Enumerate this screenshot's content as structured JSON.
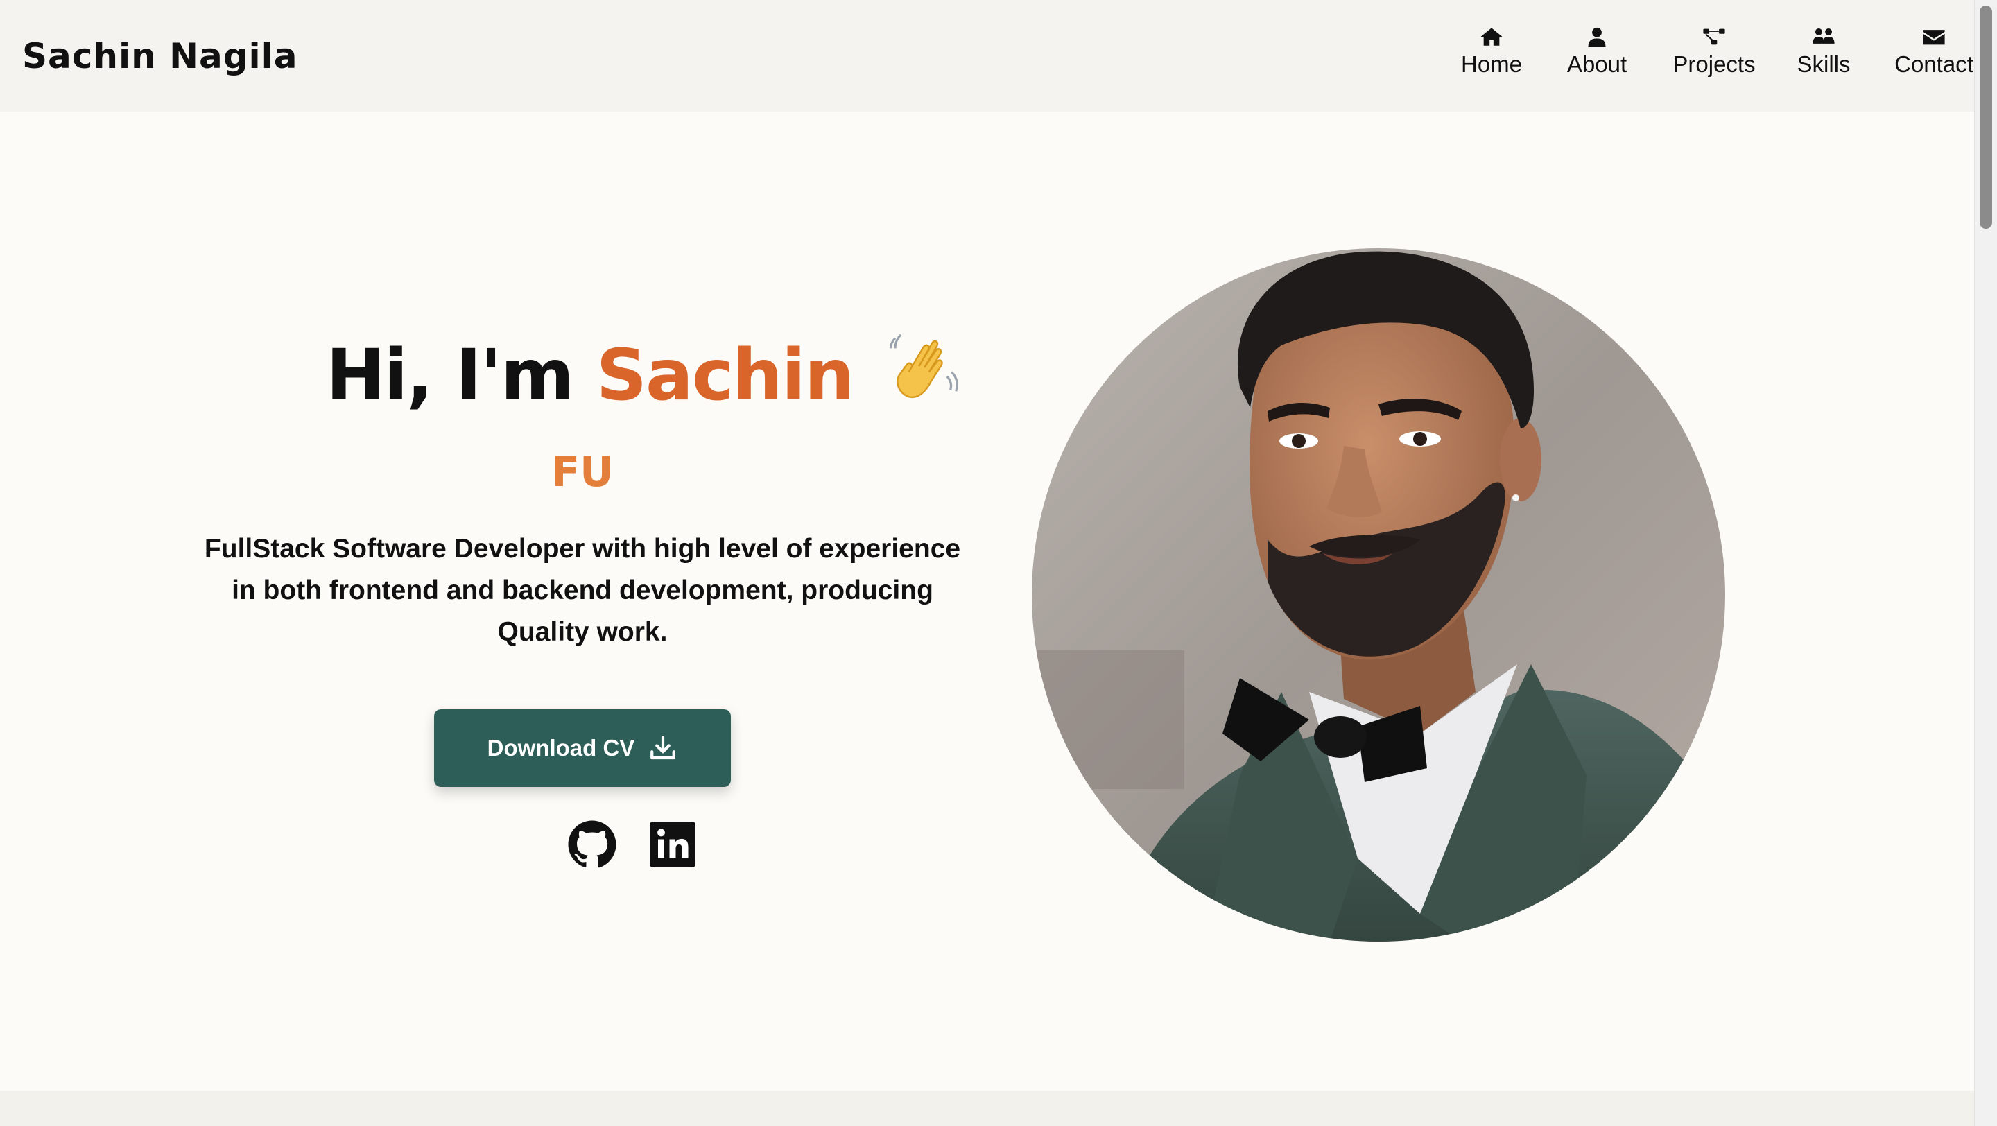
{
  "header": {
    "brand": "Sachin Nagila",
    "nav": [
      {
        "label": "Home",
        "icon": "home-icon"
      },
      {
        "label": "About",
        "icon": "user-icon"
      },
      {
        "label": "Projects",
        "icon": "project-diagram-icon"
      },
      {
        "label": "Skills",
        "icon": "skills-icon"
      },
      {
        "label": "Contact",
        "icon": "envelope-icon"
      }
    ]
  },
  "hero": {
    "greeting": "Hi, I'm",
    "name": "Sachin",
    "typed_text": "FU",
    "tagline_lines": [
      "FullStack Software Developer with high level of experience",
      "in both frontend and backend development, producing",
      "Quality work."
    ],
    "cv_button_label": "Download CV",
    "social": [
      {
        "icon": "github-icon"
      },
      {
        "icon": "linkedin-icon"
      }
    ]
  },
  "colors": {
    "accent": "#d9652b",
    "typed": "#e37f3a",
    "button": "#2e5e58",
    "nav_bg": "#f4f3ef",
    "page_bg": "#fcfbf7"
  }
}
